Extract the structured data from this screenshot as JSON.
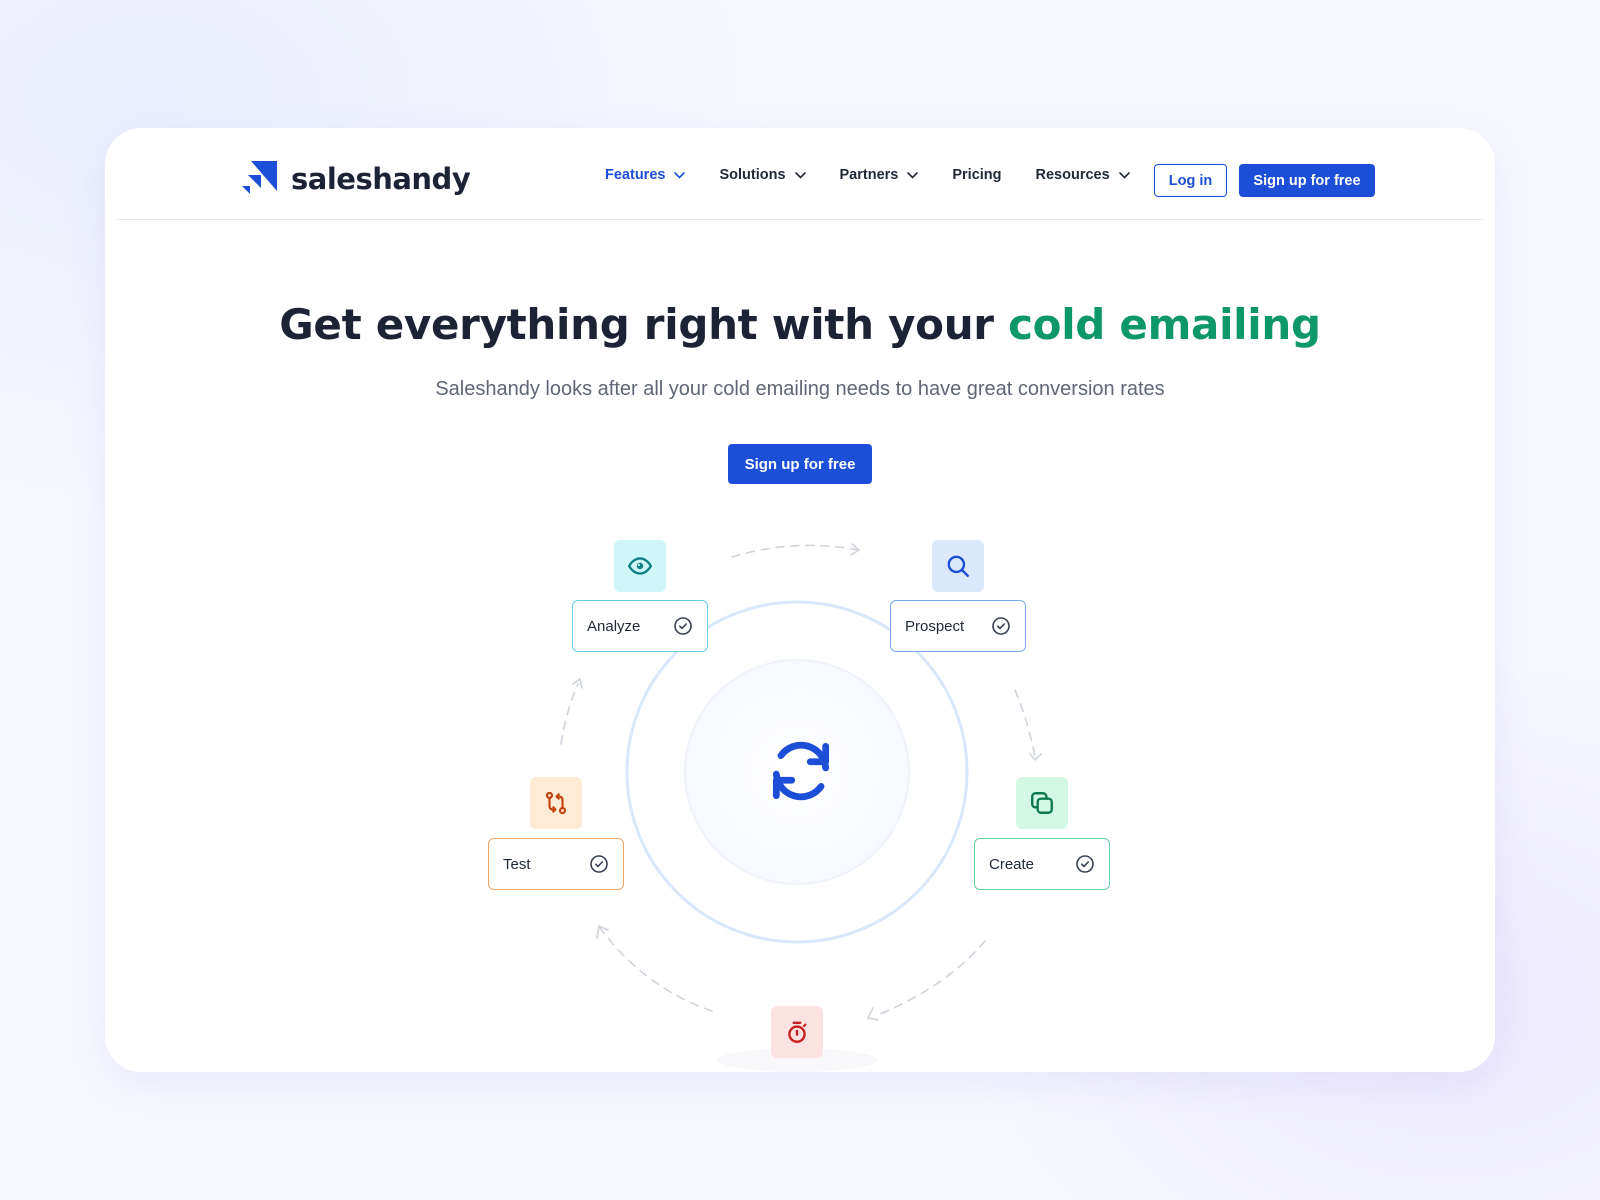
{
  "brand": {
    "name": "saleshandy",
    "color": "#1d4ed8"
  },
  "nav": {
    "items": [
      {
        "label": "Features",
        "has_dropdown": true,
        "active": true
      },
      {
        "label": "Solutions",
        "has_dropdown": true,
        "active": false
      },
      {
        "label": "Partners",
        "has_dropdown": true,
        "active": false
      },
      {
        "label": "Pricing",
        "has_dropdown": false,
        "active": false
      },
      {
        "label": "Resources",
        "has_dropdown": true,
        "active": false
      }
    ],
    "login_label": "Log in",
    "signup_label": "Sign up for free"
  },
  "hero": {
    "title_main": "Get everything right with your ",
    "title_accent": "cold emailing",
    "subtitle": "Saleshandy looks after all your cold emailing needs to have great conversion rates",
    "cta_label": "Sign up for free",
    "accent_color": "#0e9768"
  },
  "cycle": {
    "center_icon": "refresh-icon",
    "nodes": [
      {
        "label": "Analyze",
        "icon": "eye-icon",
        "icon_bg": "#cff7fa",
        "icon_color": "#0f7f86",
        "border": "#5ccfe6",
        "checked": true
      },
      {
        "label": "Prospect",
        "icon": "search-icon",
        "icon_bg": "#dce8fd",
        "icon_color": "#1d4ed8",
        "border": "#7fa9ef",
        "checked": true
      },
      {
        "label": "Create",
        "icon": "copy-icon",
        "icon_bg": "#d3f8e3",
        "icon_color": "#0e7a4d",
        "border": "#5fd5a2",
        "checked": true
      },
      {
        "label": "Test",
        "icon": "git-compare-icon",
        "icon_bg": "#fdebd6",
        "icon_color": "#c2410c",
        "border": "#f5a462",
        "checked": true
      }
    ],
    "bottom_icon": {
      "icon": "stopwatch-icon",
      "icon_bg": "#fde2e2",
      "icon_color": "#c81e1e"
    }
  }
}
